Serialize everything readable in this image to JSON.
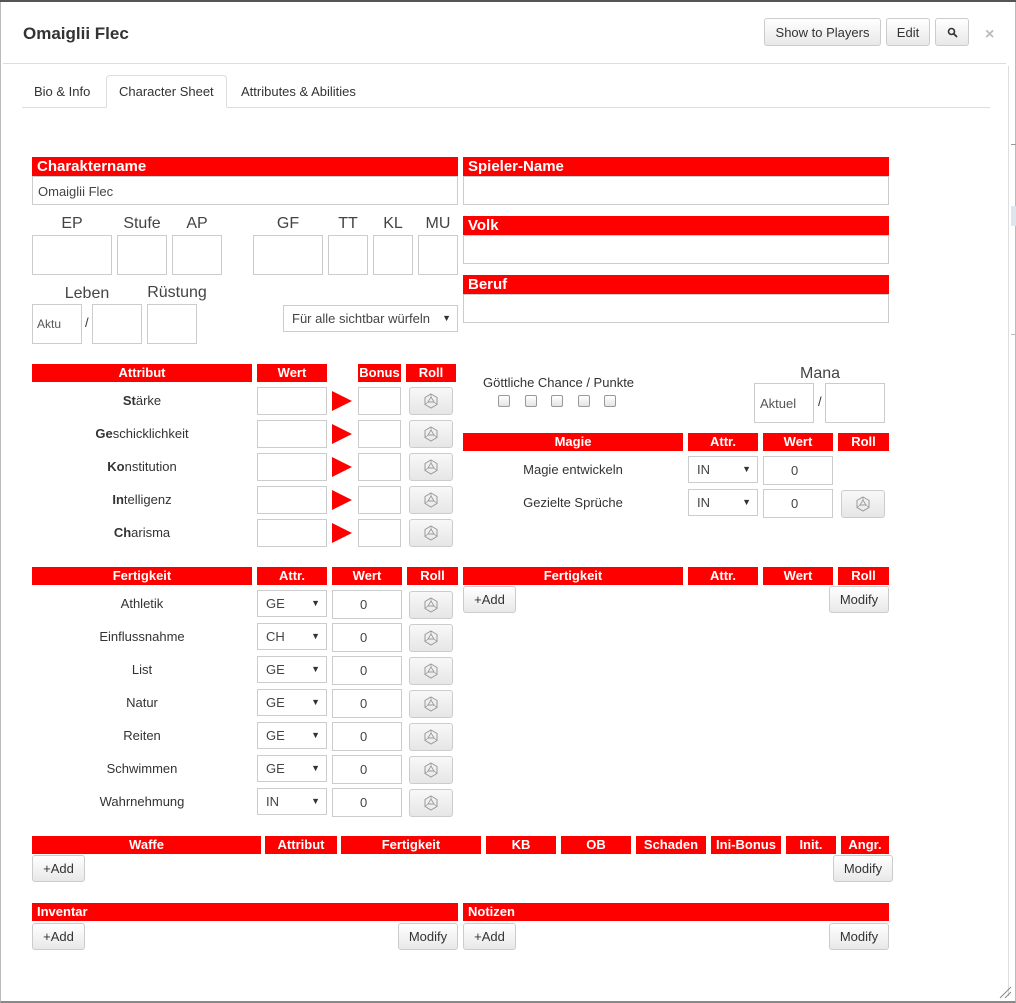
{
  "window": {
    "title": "Omaiglii Flec",
    "show_to_players": "Show to Players",
    "edit": "Edit",
    "close": "×"
  },
  "tabs": [
    "Bio & Info",
    "Character Sheet",
    "Attributes & Abilities"
  ],
  "sheet": {
    "charaktername_label": "Charaktername",
    "charaktername_value": "Omaiglii Flec",
    "spieler_label": "Spieler-Name",
    "volk_label": "Volk",
    "beruf_label": "Beruf",
    "stats": [
      "EP",
      "Stufe",
      "AP",
      "GF",
      "TT",
      "KL",
      "MU"
    ],
    "leben_label": "Leben",
    "ruestung_label": "Rüstung",
    "leben_placeholder": "Aktu",
    "slash": "/",
    "roll_mode": "Für alle sichtbar würfeln",
    "attr_headers": {
      "attribut": "Attribut",
      "wert": "Wert",
      "bonus": "Bonus",
      "roll": "Roll"
    },
    "attributes": [
      {
        "bold": "St",
        "rest": "ärke"
      },
      {
        "bold": "Ge",
        "rest": "schicklichkeit"
      },
      {
        "bold": "Ko",
        "rest": "nstitution"
      },
      {
        "bold": "In",
        "rest": "telligenz"
      },
      {
        "bold": "Ch",
        "rest": "arisma"
      }
    ],
    "goettliche_label": "Göttliche Chance / Punkte",
    "mana_label": "Mana",
    "mana_placeholder": "Aktuel",
    "magie_headers": {
      "magie": "Magie",
      "attr": "Attr.",
      "wert": "Wert",
      "roll": "Roll"
    },
    "magie_rows": [
      {
        "name": "Magie entwickeln",
        "attr": "IN",
        "value": "0"
      },
      {
        "name": "Gezielte Sprüche",
        "attr": "IN",
        "value": "0"
      }
    ],
    "skill_headers": {
      "fertigkeit": "Fertigkeit",
      "attr": "Attr.",
      "wert": "Wert",
      "roll": "Roll"
    },
    "skills": [
      {
        "name": "Athletik",
        "attr": "GE",
        "value": "0"
      },
      {
        "name": "Einflussnahme",
        "attr": "CH",
        "value": "0"
      },
      {
        "name": "List",
        "attr": "GE",
        "value": "0"
      },
      {
        "name": "Natur",
        "attr": "GE",
        "value": "0"
      },
      {
        "name": "Reiten",
        "attr": "GE",
        "value": "0"
      },
      {
        "name": "Schwimmen",
        "attr": "GE",
        "value": "0"
      },
      {
        "name": "Wahrnehmung",
        "attr": "IN",
        "value": "0"
      }
    ],
    "add_label": "+Add",
    "modify_label": "Modify",
    "weapon_headers": [
      "Waffe",
      "Attribut",
      "Fertigkeit",
      "KB",
      "OB",
      "Schaden",
      "Ini-Bonus",
      "Init.",
      "Angr."
    ],
    "inventar_label": "Inventar",
    "notizen_label": "Notizen"
  },
  "colors": {
    "accent": "#ff0000"
  },
  "icons": {
    "search": "search-icon",
    "dice": "dice-icon"
  }
}
